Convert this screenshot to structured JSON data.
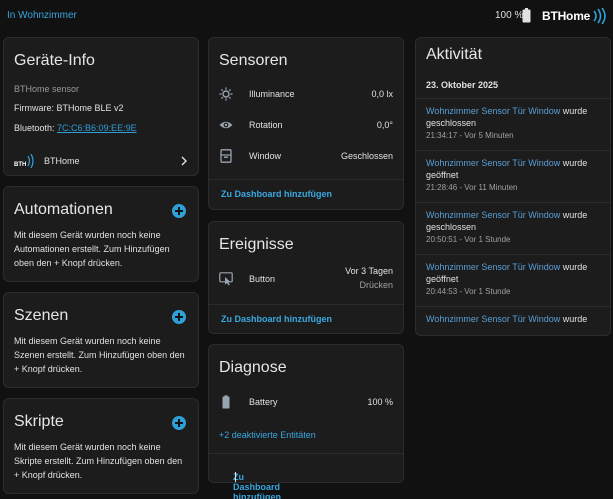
{
  "header": {
    "breadcrumb": "In Wohnzimmer",
    "battery_percent": "100 %",
    "brand": "BTHome"
  },
  "device_info": {
    "title": "Geräte-Info",
    "model": "BTHome sensor",
    "firmware": "Firmware: BTHome BLE v2",
    "bluetooth_label": "Bluetooth: ",
    "bluetooth_mac": "7C:C6:B6:09:EE:9E",
    "integration": "BTHome"
  },
  "automations": {
    "title": "Automationen",
    "text": "Mit diesem Gerät wurden noch keine Automationen erstellt. Zum Hinzufügen oben den + Knopf drücken."
  },
  "scenes": {
    "title": "Szenen",
    "text": "Mit diesem Gerät wurden noch keine Szenen erstellt. Zum Hinzufügen oben den + Knopf drücken."
  },
  "scripts": {
    "title": "Skripte",
    "text": "Mit diesem Gerät wurden noch keine Skripte erstellt. Zum Hinzufügen oben den + Knopf drücken."
  },
  "sensors": {
    "title": "Sensoren",
    "rows": [
      {
        "name": "Illuminance",
        "value": "0,0 lx",
        "icon": "brightness-icon"
      },
      {
        "name": "Rotation",
        "value": "0,0°",
        "icon": "eye-icon"
      },
      {
        "name": "Window",
        "value": "Geschlossen",
        "icon": "window-icon"
      }
    ],
    "action": "Zu Dashboard hinzufügen"
  },
  "events": {
    "title": "Ereignisse",
    "row": {
      "name": "Button",
      "value": "Vor 3 Tagen",
      "subvalue": "Drücken",
      "icon": "gesture-tap-icon"
    },
    "action": "Zu Dashboard hinzufügen"
  },
  "diagnostics": {
    "title": "Diagnose",
    "row": {
      "name": "Battery",
      "value": "100 %",
      "icon": "battery-icon"
    },
    "disabled": "+2 deaktivierte Entitäten",
    "action": "Zu Dashboard hinzufügen"
  },
  "activity": {
    "title": "Aktivität",
    "date": "23. Oktober 2025",
    "items": [
      {
        "entity": "Wohnzimmer Sensor Tür Window",
        "verb": "wurde",
        "state": "geschlossen",
        "time": "21:34:17 - Vor 5 Minuten"
      },
      {
        "entity": "Wohnzimmer Sensor Tür Window",
        "verb": "wurde",
        "state": "geöffnet",
        "time": "21:28:46 - Vor 11 Minuten"
      },
      {
        "entity": "Wohnzimmer Sensor Tür Window",
        "verb": "wurde",
        "state": "geschlossen",
        "time": "20:50:51 - Vor 1 Stunde"
      },
      {
        "entity": "Wohnzimmer Sensor Tür Window",
        "verb": "wurde",
        "state": "geöffnet",
        "time": "20:44:53 - Vor 1 Stunde"
      },
      {
        "entity": "Wohnzimmer Sensor Tür Window",
        "verb": "wurde",
        "state": "",
        "time": ""
      }
    ]
  },
  "colors": {
    "accent": "#2f9fd8",
    "card": "#1c1c1c",
    "background": "#111111"
  }
}
